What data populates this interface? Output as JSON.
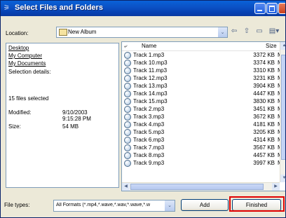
{
  "window": {
    "title": "Select Files and Folders",
    "title_icon": "⚞"
  },
  "location": {
    "label": "Location:",
    "value": "New Album",
    "drop_glyph": "⌄",
    "back_glyph": "⇦",
    "up_glyph": "⇧",
    "newfolder_glyph": "▭",
    "view_glyph": "▤▾"
  },
  "left_panel": {
    "desktop": "Desktop",
    "my_computer": "My Computer",
    "my_documents": "My Documents",
    "selection_details": "Selection details:",
    "files_selected": "15 files selected",
    "modified_label": "Modified:",
    "modified_date": "9/10/2003",
    "modified_time": "9:15:28 PM",
    "size_label": "Size:",
    "size_value": "54 MB"
  },
  "file_list": {
    "up_glyph": "⤶",
    "header_name": "Name",
    "header_size": "Size",
    "rows": [
      {
        "name": "Track 1.mp3",
        "size": "3372 KB",
        "type": "MF"
      },
      {
        "name": "Track 10.mp3",
        "size": "3374 KB",
        "type": "MF"
      },
      {
        "name": "Track 11.mp3",
        "size": "3310 KB",
        "type": "MF"
      },
      {
        "name": "Track 12.mp3",
        "size": "3231 KB",
        "type": "MF"
      },
      {
        "name": "Track 13.mp3",
        "size": "3904 KB",
        "type": "MF"
      },
      {
        "name": "Track 14.mp3",
        "size": "4447 KB",
        "type": "MF"
      },
      {
        "name": "Track 15.mp3",
        "size": "3830 KB",
        "type": "MF"
      },
      {
        "name": "Track 2.mp3",
        "size": "3451 KB",
        "type": "MF"
      },
      {
        "name": "Track 3.mp3",
        "size": "3672 KB",
        "type": "MF"
      },
      {
        "name": "Track 4.mp3",
        "size": "4181 KB",
        "type": "MF"
      },
      {
        "name": "Track 5.mp3",
        "size": "3205 KB",
        "type": "MF"
      },
      {
        "name": "Track 6.mp3",
        "size": "4314 KB",
        "type": "MF"
      },
      {
        "name": "Track 7.mp3",
        "size": "3567 KB",
        "type": "MF"
      },
      {
        "name": "Track 8.mp3",
        "size": "4457 KB",
        "type": "MF"
      },
      {
        "name": "Track 9.mp3",
        "size": "3997 KB",
        "type": "MF"
      }
    ],
    "scroll_up": "▲",
    "scroll_down": "▼",
    "scroll_left": "◀",
    "scroll_right": "▶"
  },
  "bottom": {
    "file_types_label": "File types:",
    "file_types_value": "All Formats  (*.mp4,*.wave,*.wav,*.wave,*.w",
    "drop_glyph": "⌄",
    "add_label": "Add",
    "finished_label": "Finished"
  },
  "colors": {
    "titlebar": "#0b4fc3",
    "highlight": "#e00000"
  }
}
